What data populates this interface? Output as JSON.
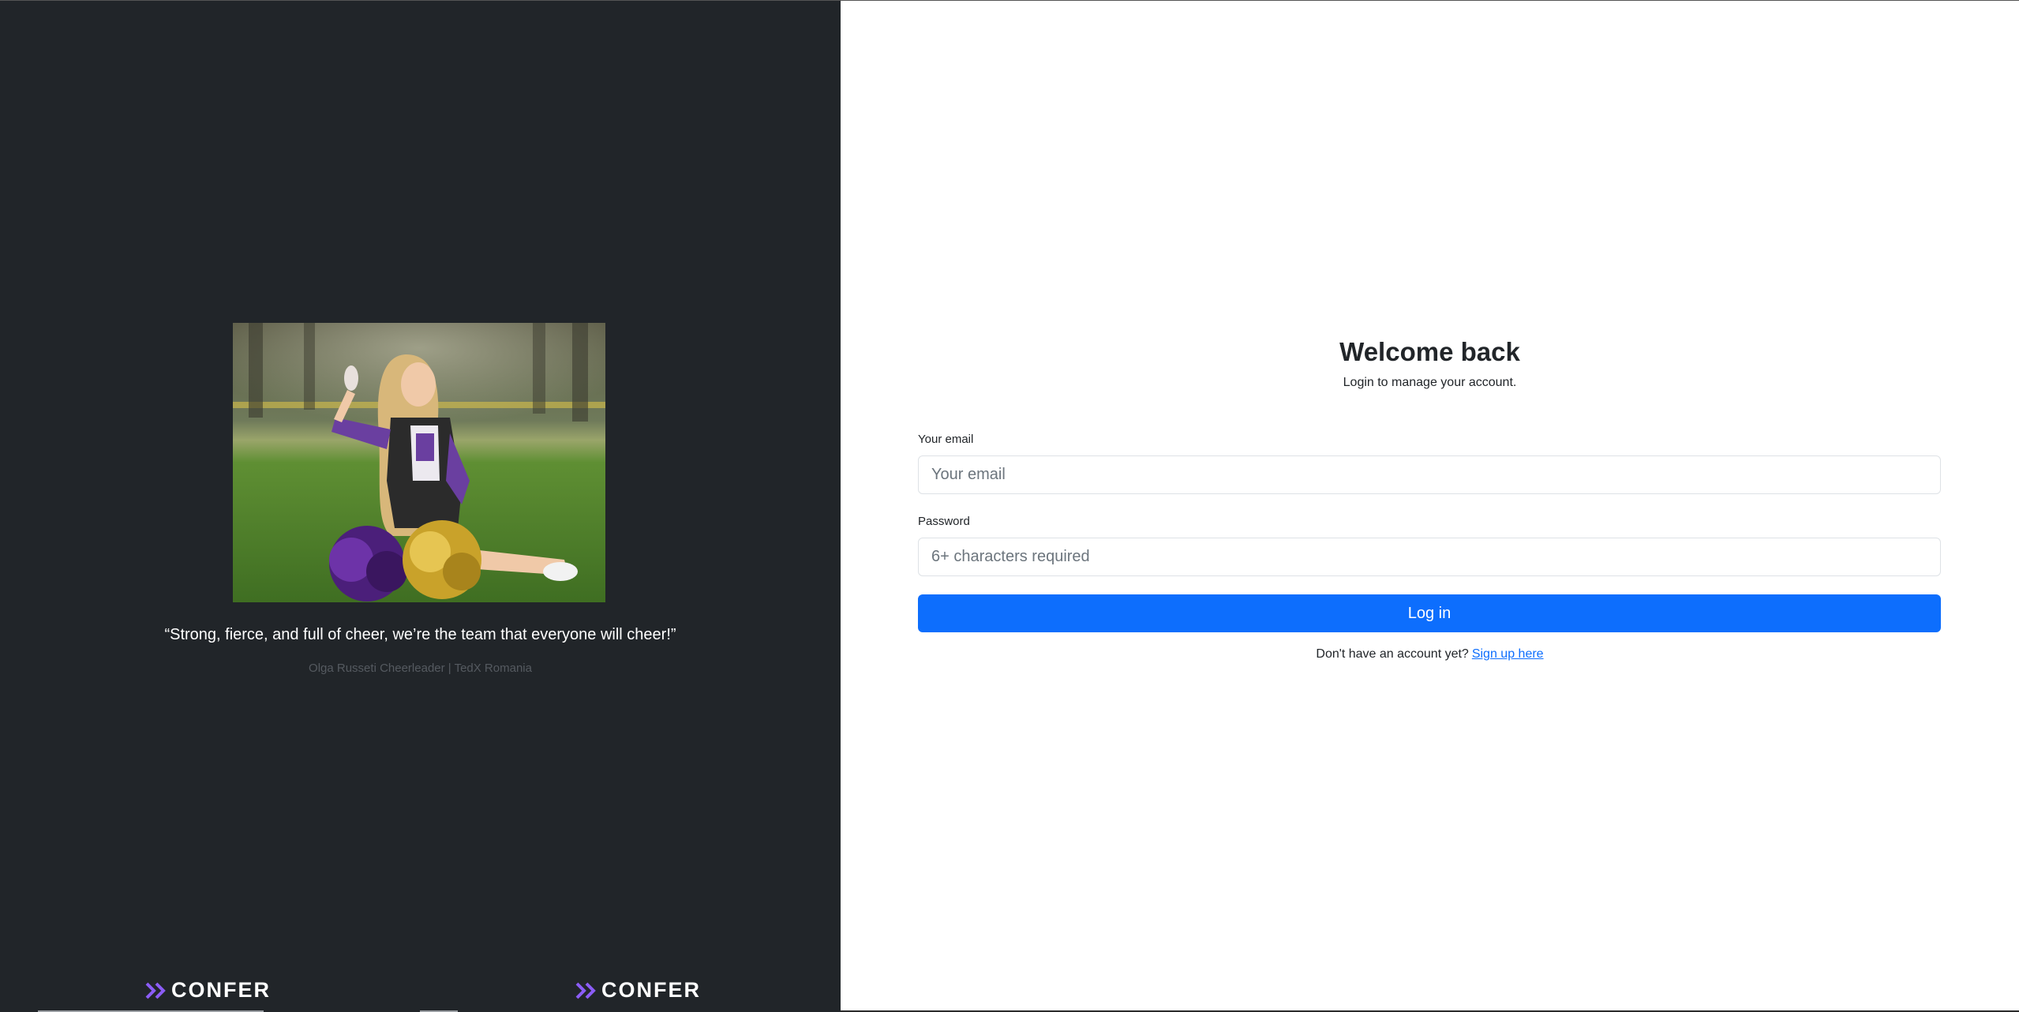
{
  "hero": {
    "quote": "“Strong, fierce, and full of cheer, we’re the team that everyone will cheer!”",
    "attribution": "Olga Russeti Cheerleader | TedX Romania"
  },
  "brand": {
    "logos": [
      "CONFER",
      "CONFER"
    ],
    "accent": "#8b5cf6"
  },
  "login": {
    "title": "Welcome back",
    "subtitle": "Login to manage your account.",
    "email_label": "Your email",
    "email_placeholder": "Your email",
    "password_label": "Password",
    "password_placeholder": "6+ characters required",
    "submit_label": "Log in",
    "signup_prompt": "Don't have an account yet?",
    "signup_link": "Sign up here"
  },
  "colors": {
    "left_panel": "#212529",
    "primary": "#0d6efd"
  }
}
